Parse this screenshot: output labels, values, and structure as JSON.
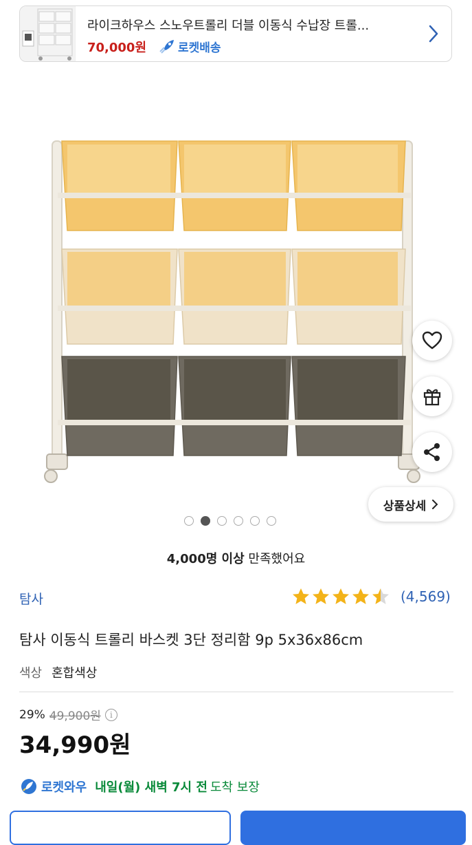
{
  "banner": {
    "title": "라이크하우스 스노우트롤리 더블 이동식 수납장 트롤...",
    "price": "70,000원",
    "shipping": "로켓배송"
  },
  "carousel": {
    "dot_count": 6,
    "active_index": 1
  },
  "detail_button": "상품상세",
  "satisfaction": {
    "bold": "4,000명 이상",
    "rest": " 만족했어요"
  },
  "brand": "탐사",
  "rating": {
    "stars": 4.5,
    "count": "(4,569)"
  },
  "product_title": "탐사 이동식 트롤리 바스켓 3단 정리함 9p 5x36x86cm",
  "option": {
    "label": "색상",
    "value": "혼합색상"
  },
  "discount": {
    "percent": "29%",
    "original": "49,900원"
  },
  "price": "34,990원",
  "delivery": {
    "brand": "로켓와우",
    "date": "내일(월) 새벽 7시 전",
    "guarantee": "도착 보장"
  },
  "colors": {
    "brand_blue": "#2f62b4",
    "sale_red": "#c8201b",
    "star": "#f3b319",
    "cta_blue": "#2f6fe0",
    "green": "#0a8a3a"
  }
}
